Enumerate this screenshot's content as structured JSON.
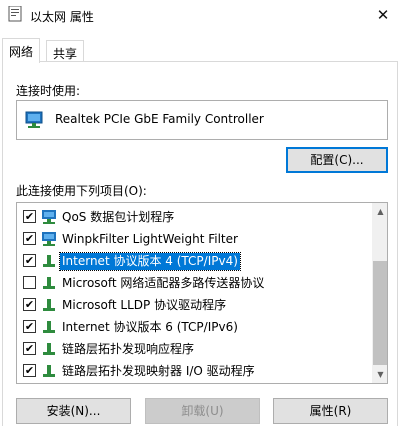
{
  "window": {
    "title": "以太网 属性",
    "close_glyph": "✕"
  },
  "tabs": [
    {
      "label": "网络",
      "active": true
    },
    {
      "label": "共享",
      "active": false
    }
  ],
  "connect_using_label": "连接时使用:",
  "adapter_name": "Realtek PCIe GbE Family Controller",
  "configure_button": "配置(C)...",
  "items_label": "此连接使用下列项目(O):",
  "items": [
    {
      "label": "QoS 数据包计划程序",
      "checked": true,
      "icon": "network-service-icon"
    },
    {
      "label": "WinpkFilter LightWeight Filter",
      "checked": true,
      "icon": "network-service-icon"
    },
    {
      "label": "Internet 协议版本 4 (TCP/IPv4)",
      "checked": true,
      "icon": "protocol-icon",
      "selected": true
    },
    {
      "label": "Microsoft 网络适配器多路传送器协议",
      "checked": false,
      "icon": "protocol-icon"
    },
    {
      "label": "Microsoft LLDP 协议驱动程序",
      "checked": true,
      "icon": "protocol-icon"
    },
    {
      "label": "Internet 协议版本 6 (TCP/IPv6)",
      "checked": true,
      "icon": "protocol-icon"
    },
    {
      "label": "链路层拓扑发现响应程序",
      "checked": true,
      "icon": "protocol-icon"
    },
    {
      "label": "链路层拓扑发现映射器 I/O 驱动程序",
      "checked": true,
      "icon": "protocol-icon"
    }
  ],
  "buttons": {
    "install": "安装(N)...",
    "uninstall": "卸载(U)",
    "properties": "属性(R)"
  },
  "colors": {
    "selection": "#0078d7",
    "protocol_green": "#2e8b3e",
    "monitor_blue": "#1e73be"
  }
}
